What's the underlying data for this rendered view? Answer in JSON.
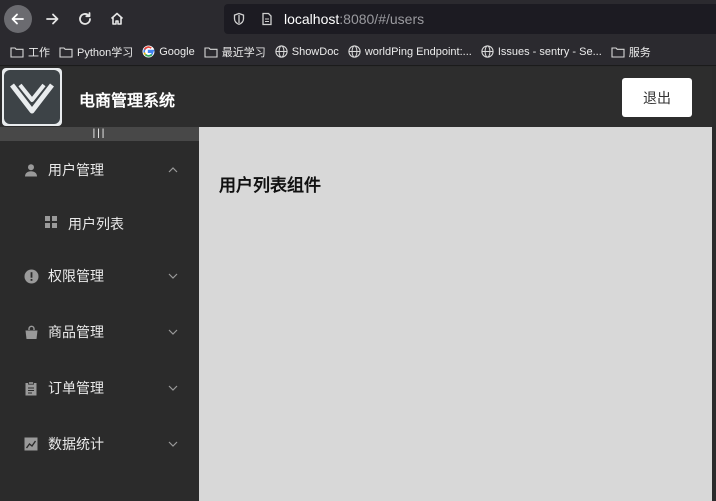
{
  "browser": {
    "url_host": "localhost",
    "url_rest": ":8080/#/users",
    "bookmarks": [
      {
        "label": "工作",
        "icon": "folder-icon"
      },
      {
        "label": "Python学习",
        "icon": "folder-icon"
      },
      {
        "label": "Google",
        "icon": "google-icon"
      },
      {
        "label": "最近学习",
        "icon": "folder-icon"
      },
      {
        "label": "ShowDoc",
        "icon": "globe-icon"
      },
      {
        "label": "worldPing Endpoint:...",
        "icon": "globe-icon"
      },
      {
        "label": "Issues - sentry - Se...",
        "icon": "globe-icon"
      },
      {
        "label": "服务",
        "icon": "folder-icon"
      }
    ]
  },
  "header": {
    "title": "电商管理系统",
    "logout_label": "退出"
  },
  "sidebar": {
    "toggle_label": "|||",
    "items": [
      {
        "label": "用户管理",
        "icon": "user-icon",
        "expanded": true
      },
      {
        "label": "权限管理",
        "icon": "warning-icon",
        "expanded": false
      },
      {
        "label": "商品管理",
        "icon": "shopping-bag-icon",
        "expanded": false
      },
      {
        "label": "订单管理",
        "icon": "clipboard-icon",
        "expanded": false
      },
      {
        "label": "数据统计",
        "icon": "chart-icon",
        "expanded": false
      }
    ],
    "sub_items": [
      {
        "label": "用户列表",
        "icon": "grid-icon"
      }
    ]
  },
  "main": {
    "title": "用户列表组件"
  },
  "colors": {
    "sidebar_bg": "#2b2b2b",
    "main_bg": "#d8d8d8",
    "header_bg": "#2d2d2d"
  }
}
